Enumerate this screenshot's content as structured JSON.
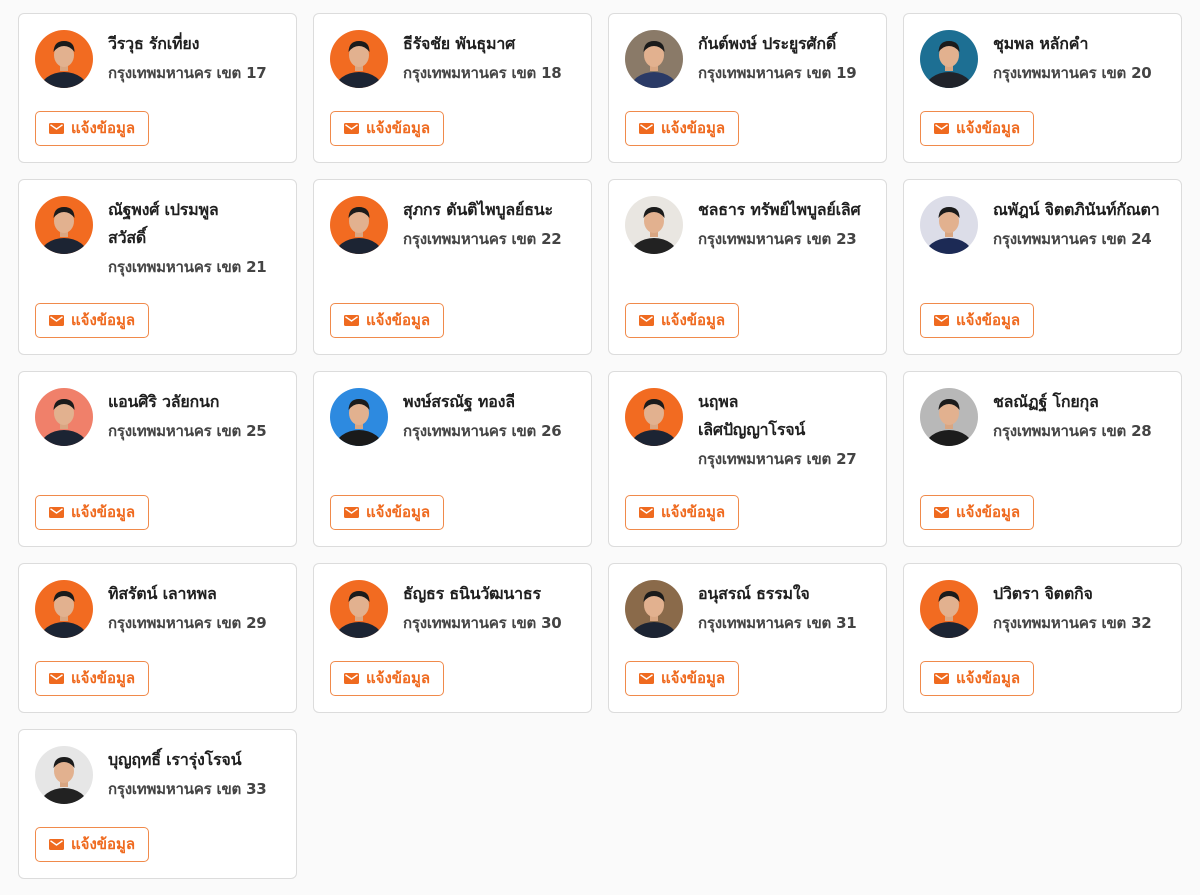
{
  "button_label": "แจ้งข้อมูล",
  "colors": {
    "accent": "#ef6a1f",
    "border": "#dcdcdc"
  },
  "icons": {
    "button": "mail-icon"
  },
  "rows": [
    [
      {
        "name": "วีรวุธ รักเที่ยง",
        "district": "กรุงเทพมหานคร เขต 17",
        "bg": "#f26b21",
        "shirt": "#1c2433"
      },
      {
        "name": "ธีรัจชัย พันธุมาศ",
        "district": "กรุงเทพมหานคร เขต 18",
        "bg": "#f26b21",
        "shirt": "#1c2433"
      },
      {
        "name": "กันต์พงษ์ ประยูรศักดิ์",
        "district": "กรุงเทพมหานคร เขต 19",
        "bg": "#8a7a68",
        "shirt": "#2a3a66"
      },
      {
        "name": "ชุมพล หลักคำ",
        "district": "กรุงเทพมหานคร เขต 20",
        "bg": "#1d6f93",
        "shirt": "#20232a"
      }
    ],
    [
      {
        "name": "ณัฐพงศ์ เปรมพูลสวัสดิ์",
        "district": "กรุงเทพมหานคร เขต 21",
        "bg": "#f26b21",
        "shirt": "#1c2433"
      },
      {
        "name": "สุภกร ตันติไพบูลย์ธนะ",
        "district": "กรุงเทพมหานคร เขต 22",
        "bg": "#f26b21",
        "shirt": "#1c2433"
      },
      {
        "name": "ชลธาร ทรัพย์ไพบูลย์เลิศ",
        "district": "กรุงเทพมหานคร เขต 23",
        "bg": "#e9e6e1",
        "shirt": "#222222"
      },
      {
        "name": "ณพัฎน์ จิตตภินันท์กัณตา",
        "district": "กรุงเทพมหานคร เขต 24",
        "bg": "#dcdde8",
        "shirt": "#1c2a55"
      }
    ],
    [
      {
        "name": "แอนศิริ วลัยกนก",
        "district": "กรุงเทพมหานคร เขต 25",
        "bg": "#f0806a",
        "shirt": "#1c2433"
      },
      {
        "name": "พงษ์สรณัฐ ทองลี",
        "district": "กรุงเทพมหานคร เขต 26",
        "bg": "#2d8ae0",
        "shirt": "#1a1a1a"
      },
      {
        "name": "นฤพล เลิศปัญญาโรจน์",
        "district": "กรุงเทพมหานคร เขต 27",
        "bg": "#f26b21",
        "shirt": "#1c2433"
      },
      {
        "name": "ชลณัฏฐ์ โกยกุล",
        "district": "กรุงเทพมหานคร เขต 28",
        "bg": "#b8b8b8",
        "shirt": "#1c1c1c"
      }
    ],
    [
      {
        "name": "ทิสรัตน์ เลาหพล",
        "district": "กรุงเทพมหานคร เขต 29",
        "bg": "#f26b21",
        "shirt": "#1c2433"
      },
      {
        "name": "ธัญธร ธนินวัฒนาธร",
        "district": "กรุงเทพมหานคร เขต 30",
        "bg": "#f26b21",
        "shirt": "#1c2433"
      },
      {
        "name": "อนุสรณ์ ธรรมใจ",
        "district": "กรุงเทพมหานคร เขต 31",
        "bg": "#8a6a4a",
        "shirt": "#1c2433"
      },
      {
        "name": "ปวิตรา จิตตกิจ",
        "district": "กรุงเทพมหานคร เขต 32",
        "bg": "#f26b21",
        "shirt": "#1c2433"
      }
    ],
    [
      {
        "name": "บุญฤทธิ์ เรารุ่งโรจน์",
        "district": "กรุงเทพมหานคร เขต 33",
        "bg": "#e6e6e6",
        "shirt": "#222222"
      }
    ]
  ]
}
